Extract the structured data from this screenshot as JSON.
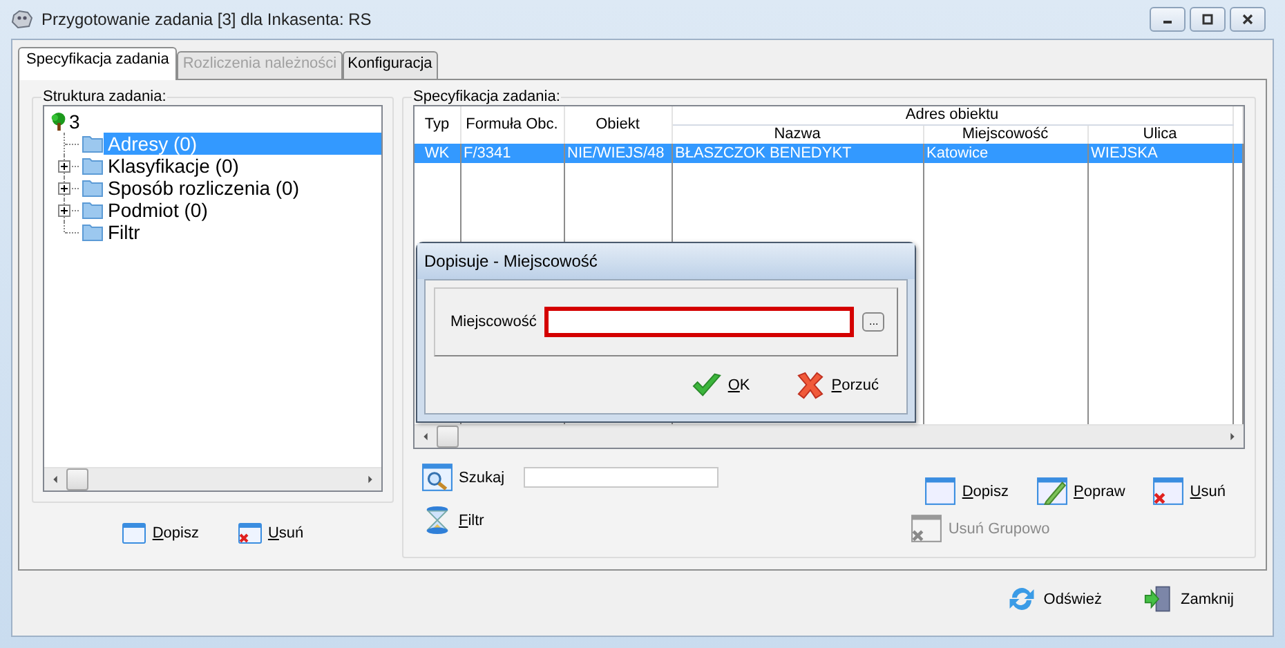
{
  "window": {
    "title": "Przygotowanie zadania [3] dla Inkasenta: RS"
  },
  "tabs": [
    {
      "label": "Specyfikacja zadania",
      "selected": true,
      "disabled": false
    },
    {
      "label": "Rozliczenia należności",
      "selected": false,
      "disabled": true
    },
    {
      "label": "Konfiguracja",
      "selected": false,
      "disabled": false
    }
  ],
  "structure": {
    "title": "Struktura zadania:",
    "tree": {
      "label": "3",
      "children": [
        {
          "label": "Adresy (0)",
          "selected": true
        },
        {
          "label": "Klasyfikacje (0)",
          "selected": false,
          "expanded": false
        },
        {
          "label": "Sposób rozliczenia (0)",
          "selected": false,
          "expanded": false
        },
        {
          "label": "Podmiot (0)",
          "selected": false,
          "expanded": false
        },
        {
          "label": "Filtr",
          "selected": false
        }
      ]
    },
    "buttons": [
      {
        "label": "Dopisz",
        "kind": "add"
      },
      {
        "label": "Usuń",
        "kind": "delete"
      }
    ]
  },
  "specification": {
    "title": "Specyfikacja zadania:",
    "group_header": "Adres obiektu",
    "columns": [
      "Typ",
      "Formuła Obc.",
      "Obiekt",
      "Nazwa",
      "Miejscowość",
      "Ulica"
    ],
    "rows": [
      {
        "cells": [
          "WK",
          "F/3341",
          "NIE/WIEJS/48",
          "BŁASZCZOK BENEDYKT",
          "Katowice",
          "WIEJSKA"
        ],
        "selected": true
      }
    ],
    "search_button": "Szukaj",
    "filter_button": "Filtr",
    "buttons": [
      {
        "label": "Dopisz",
        "kind": "add",
        "disabled": false
      },
      {
        "label": "Popraw",
        "kind": "edit",
        "disabled": false
      },
      {
        "label": "Usuń",
        "kind": "delete",
        "disabled": false
      }
    ],
    "group_delete": {
      "label": "Usuń Grupowo",
      "kind": "delete",
      "disabled": true
    }
  },
  "dialog": {
    "title": "Dopisuje - Miejscowość",
    "field_label": "Miejscowość",
    "browse_button": "...",
    "ok": "OK",
    "cancel": "Porzuć"
  },
  "footer": [
    {
      "label": "Odśwież",
      "kind": "refresh"
    },
    {
      "label": "Zamknij",
      "kind": "exit"
    }
  ]
}
